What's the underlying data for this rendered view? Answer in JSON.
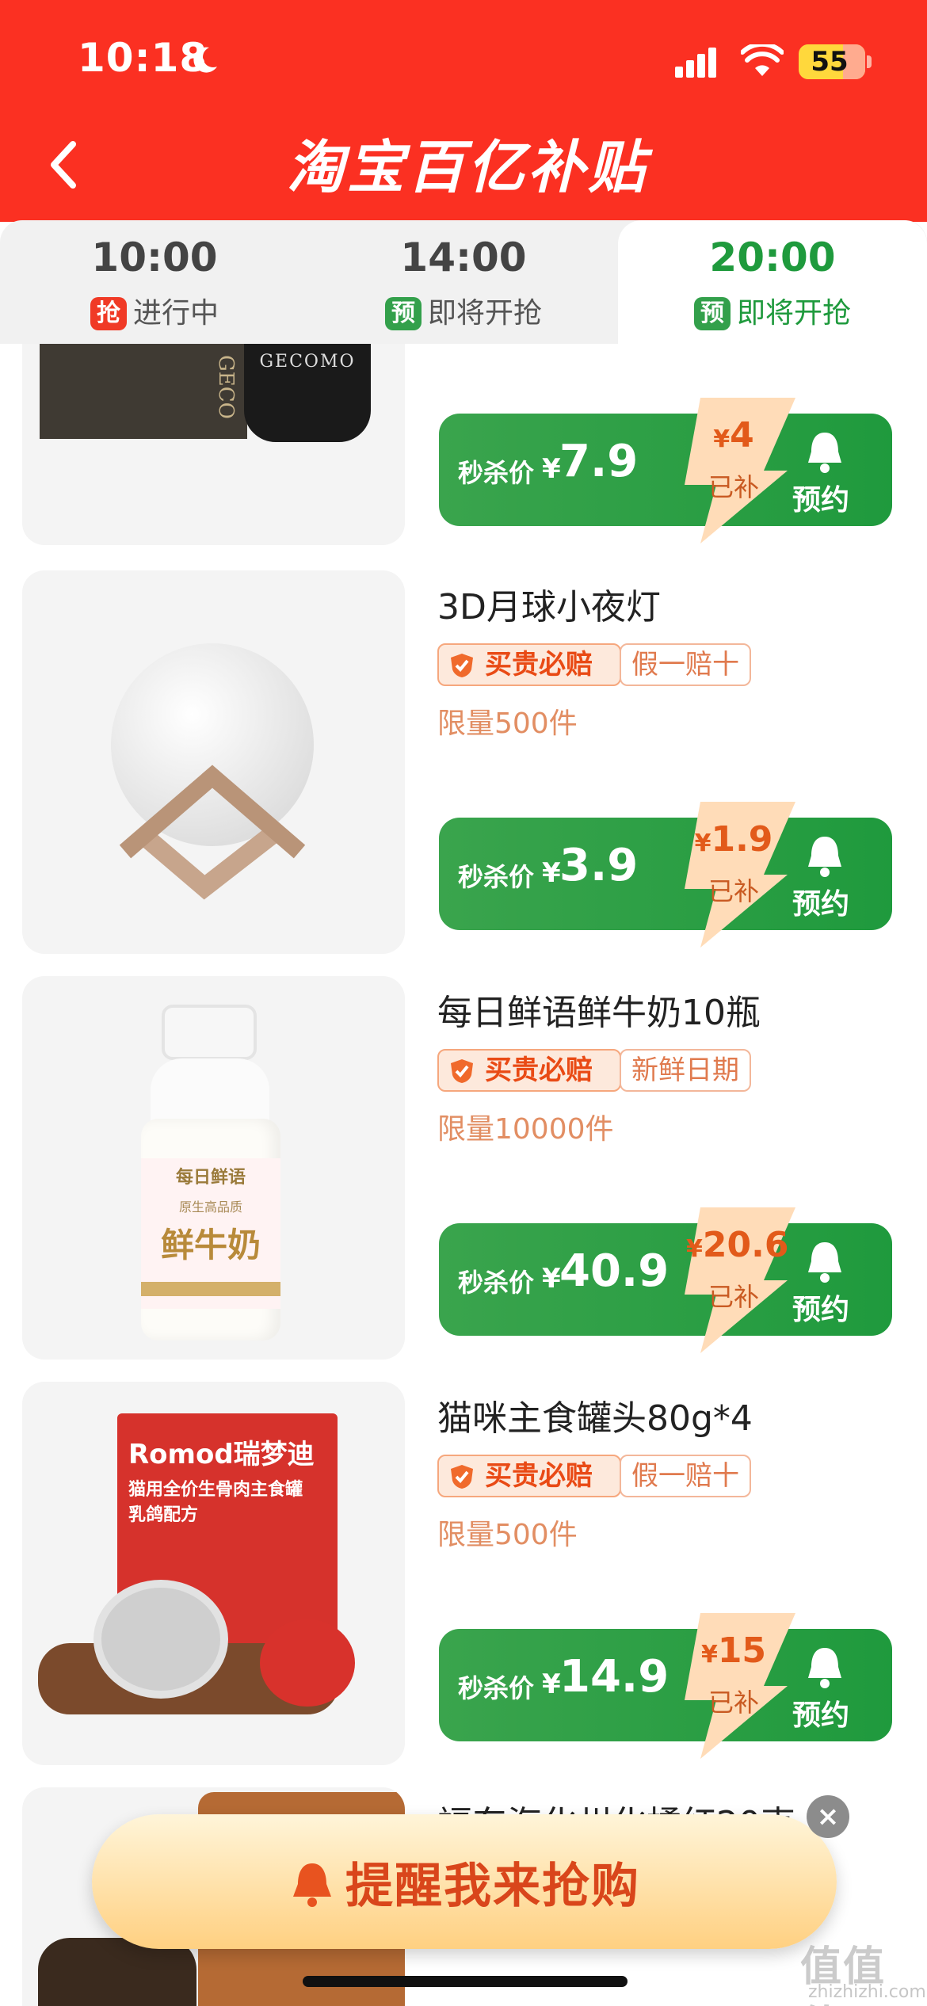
{
  "status_bar": {
    "time": "10:18",
    "battery": "55"
  },
  "header": {
    "title": "淘宝百亿补贴"
  },
  "tabs": [
    {
      "time": "10:00",
      "badge": "抢",
      "status": "进行中",
      "badge_color": "#f03a26"
    },
    {
      "time": "14:00",
      "badge": "预",
      "status": "即将开抢",
      "badge_color": "#33a04b"
    },
    {
      "time": "20:00",
      "badge": "预",
      "status": "即将开抢",
      "badge_color": "#33a04b",
      "active": true
    }
  ],
  "partial_product": {
    "brand_text": "GECOMO",
    "brand_text_vertical": "GECO",
    "price_label": "秒杀价",
    "currency": "¥",
    "price": "7.9",
    "subsidy_currency": "¥",
    "subsidy": "4",
    "subsidy_label": "已补",
    "reserve_label": "预约"
  },
  "products": [
    {
      "name": "3D月球小夜灯",
      "tag_main": "买贵必赔",
      "tag_secondary": "假一赔十",
      "limit": "限量500件",
      "price_label": "秒杀价",
      "currency": "¥",
      "price": "3.9",
      "subsidy_currency": "¥",
      "subsidy": "1.9",
      "subsidy_label": "已补",
      "reserve_label": "预约"
    },
    {
      "name": "每日鲜语鲜牛奶10瓶",
      "tag_main": "买贵必赔",
      "tag_secondary": "新鲜日期",
      "limit": "限量10000件",
      "price_label": "秒杀价",
      "currency": "¥",
      "price": "40.9",
      "subsidy_currency": "¥",
      "subsidy": "20.6",
      "subsidy_label": "已补",
      "reserve_label": "预约",
      "image_text": {
        "brand": "每日鲜语",
        "small": "原生高品质",
        "big": "鲜牛奶"
      }
    },
    {
      "name": "猫咪主食罐头80g*4",
      "tag_main": "买贵必赔",
      "tag_secondary": "假一赔十",
      "limit": "限量500件",
      "price_label": "秒杀价",
      "currency": "¥",
      "price": "14.9",
      "subsidy_currency": "¥",
      "subsidy": "15",
      "subsidy_label": "已补",
      "reserve_label": "预约",
      "image_text": {
        "brand": "Romod瑞梦迪",
        "line1": "猫用全价生骨肉主食罐",
        "line2": "乳鸽配方"
      }
    }
  ],
  "next_product_partial": {
    "name": "福东海化州化橘红20克"
  },
  "remind_button": {
    "label": "提醒我来抢购"
  },
  "close_label": "×",
  "watermark": {
    "main": "值值值",
    "sub": "zhizhizhi.com"
  },
  "colors": {
    "header_red": "#fb3022",
    "green": "#1f9a3d",
    "orange_text": "#e94a15"
  }
}
